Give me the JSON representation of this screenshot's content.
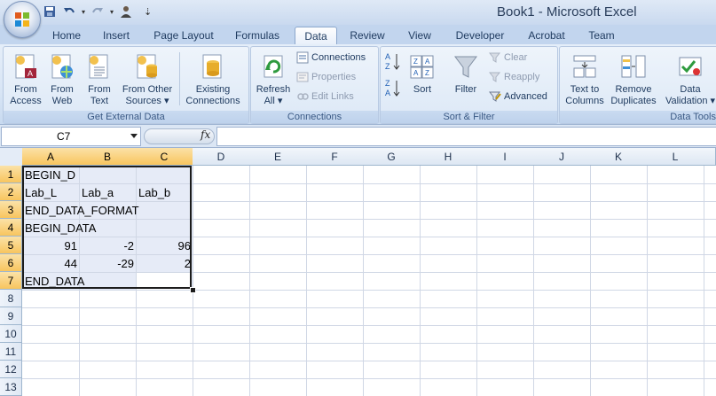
{
  "window": {
    "title": "Book1 - Microsoft Excel"
  },
  "qat": {
    "icons": [
      "save-icon",
      "undo-icon",
      "redo-icon",
      "user-icon",
      "customize-icon"
    ]
  },
  "tabs": [
    "Home",
    "Insert",
    "Page Layout",
    "Formulas",
    "Data",
    "Review",
    "View",
    "Developer",
    "Acrobat",
    "Team"
  ],
  "active_tab": "Data",
  "ribbon": {
    "get_external": {
      "label": "Get External Data",
      "from_access": [
        "From",
        "Access"
      ],
      "from_web": [
        "From",
        "Web"
      ],
      "from_text": [
        "From",
        "Text"
      ],
      "from_other": [
        "From Other",
        "Sources"
      ],
      "existing": [
        "Existing",
        "Connections"
      ]
    },
    "connections": {
      "label": "Connections",
      "refresh": [
        "Refresh",
        "All"
      ],
      "connections": "Connections",
      "properties": "Properties",
      "edit_links": "Edit Links"
    },
    "sort_filter": {
      "label": "Sort & Filter",
      "sort": "Sort",
      "filter": "Filter",
      "clear": "Clear",
      "reapply": "Reapply",
      "advanced": "Advanced"
    },
    "data_tools": {
      "label": "Data Tools",
      "text_to_columns": [
        "Text to",
        "Columns"
      ],
      "remove_duplicates": [
        "Remove",
        "Duplicates"
      ],
      "data_validation": [
        "Data",
        "Validation"
      ]
    }
  },
  "formula_bar": {
    "name_box": "C7",
    "fx": "fx",
    "content": ""
  },
  "sheet": {
    "columns": [
      "A",
      "B",
      "C",
      "D",
      "E",
      "F",
      "G",
      "H",
      "I",
      "J",
      "K",
      "L"
    ],
    "rows": [
      "1",
      "2",
      "3",
      "4",
      "5",
      "6",
      "7",
      "8",
      "9",
      "10",
      "11",
      "12",
      "13"
    ],
    "cells": {
      "A1": "BEGIN_D",
      "A2": "Lab_L",
      "B2": "Lab_a",
      "C2": "Lab_b",
      "A3": "END_DATA_FORMAT",
      "A4": "BEGIN_DATA",
      "A5": "91",
      "B5": "-2",
      "C5": "96",
      "A6": "44",
      "B6": "-29",
      "C6": "2",
      "A7": "END_DATA"
    }
  }
}
